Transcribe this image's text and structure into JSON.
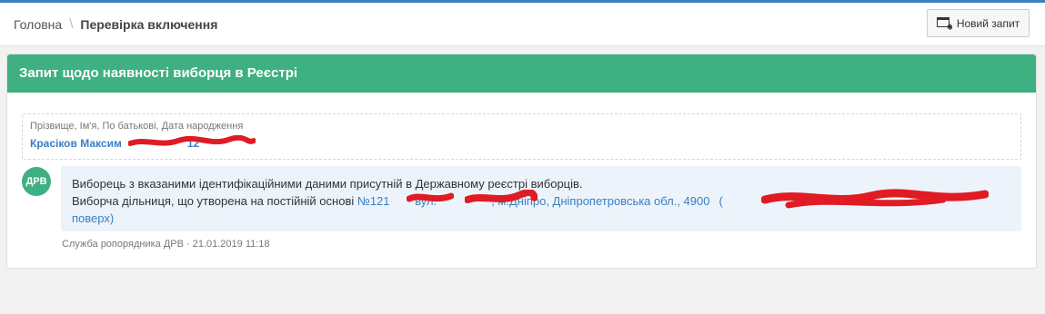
{
  "breadcrumb": {
    "home": "Головна",
    "separator": "\\",
    "current": "Перевірка включення"
  },
  "toolbar": {
    "new_request_label": "Новий запит"
  },
  "panel": {
    "title": "Запит щодо наявності виборця в Реєстрі"
  },
  "query_field": {
    "label": "Прізвище, Ім'я, По батькові, Дата народження",
    "value": "Красіков Максим",
    "value_suffix": "12"
  },
  "message": {
    "avatar": "ДРВ",
    "line1": "Виборець з вказаними ідентифікаційними даними присутній в Державному реєстрі виборців.",
    "line2_prefix": "Виборча дільниця, що утворена на постійній основі",
    "station_no": "№121",
    "address_street": "вул.",
    "address_city": ", м.Дніпро, Дніпропетровська обл., 4900",
    "address_tail": "(",
    "line3": "поверх)"
  },
  "meta": {
    "author_date": "Служба ропорядника ДРВ · 21.01.2019 11:18"
  },
  "colors": {
    "accent_green": "#3eb082",
    "link_blue": "#3a7fc4",
    "redaction_red": "#e01b24",
    "message_bg": "#ecf3fa"
  }
}
